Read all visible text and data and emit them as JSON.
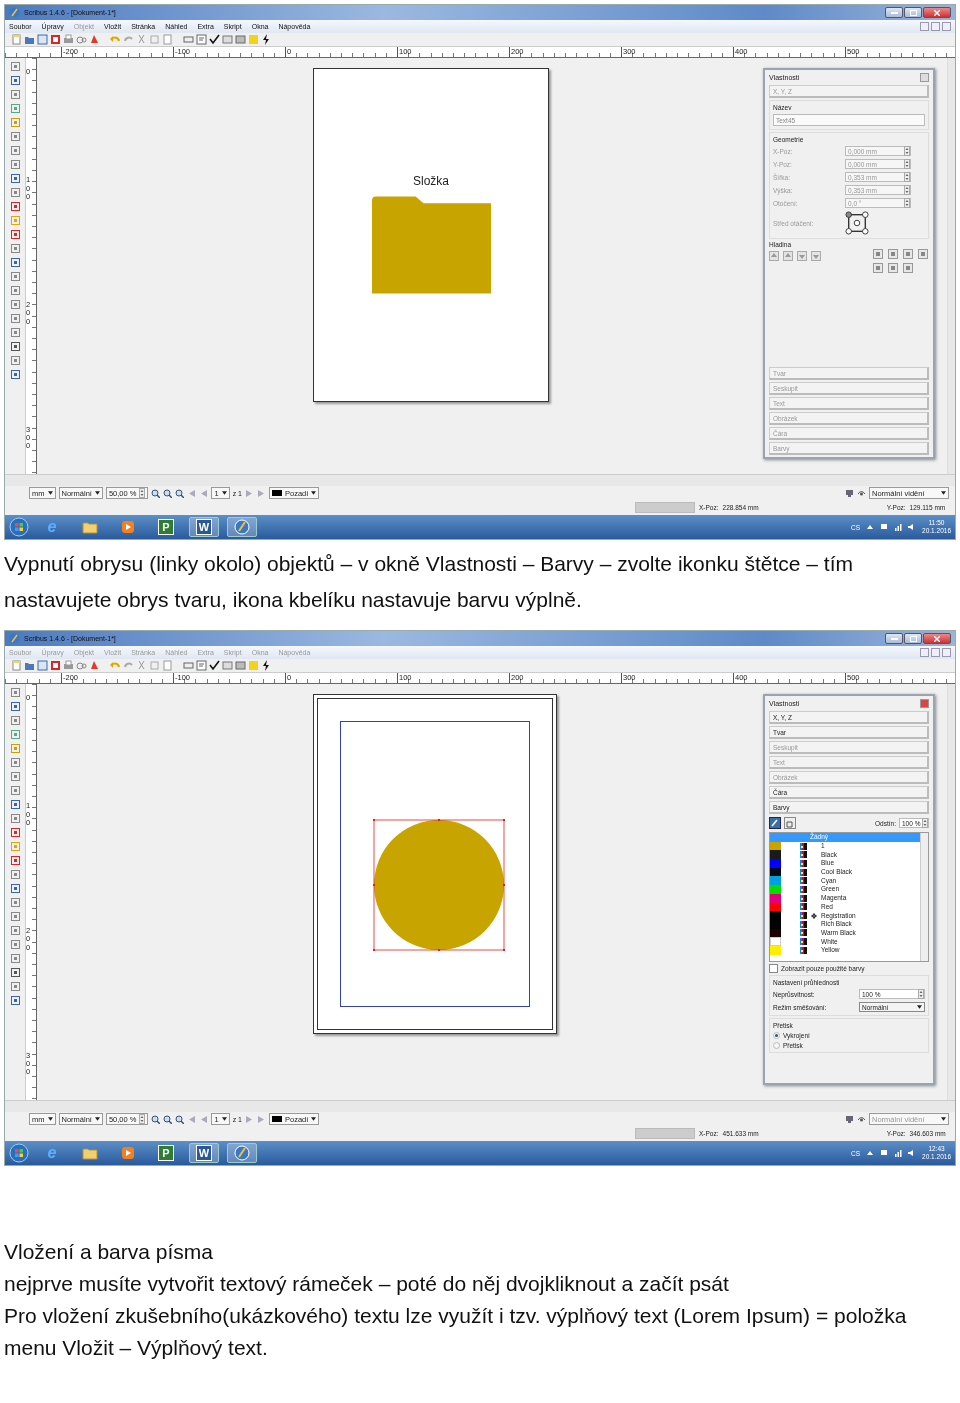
{
  "blocks": [
    {
      "kind": "screenshot",
      "title": "Scribus 1.4.6 - [Dokument-1*]",
      "menu": [
        {
          "label": "Soubor",
          "disabled": false
        },
        {
          "label": "Úpravy",
          "disabled": false
        },
        {
          "label": "Objekt",
          "disabled": true
        },
        {
          "label": "Vložit",
          "disabled": false
        },
        {
          "label": "Stránka",
          "disabled": false
        },
        {
          "label": "Náhled",
          "disabled": false
        },
        {
          "label": "Extra",
          "disabled": false
        },
        {
          "label": "Skript",
          "disabled": false
        },
        {
          "label": "Okna",
          "disabled": false
        },
        {
          "label": "Nápověda",
          "disabled": false
        }
      ],
      "ruler": [
        "-200",
        "-100",
        "0",
        "100",
        "200",
        "300",
        "400",
        "500"
      ],
      "vruler": [
        "0",
        "100",
        "200",
        "300"
      ],
      "canvas": {
        "kind": "folder",
        "label": "Složka"
      },
      "panel": {
        "kind": "geometry",
        "title": "Vlastnosti",
        "top_sections": [
          {
            "label": "X, Y, Z",
            "disabled": true
          }
        ],
        "name_label": "Název",
        "name_value": "Text45",
        "geometry_label": "Geometrie",
        "fields": [
          {
            "label": "X-Poz:",
            "value": "0,000 mm",
            "disabled": true
          },
          {
            "label": "Y-Poz:",
            "value": "0,000 mm",
            "disabled": true
          },
          {
            "label": "Šířka:",
            "value": "0,353 mm",
            "disabled": true
          },
          {
            "label": "Výška:",
            "value": "0,353 mm",
            "disabled": true
          },
          {
            "label": "Otočení:",
            "value": "0,0 °",
            "disabled": true
          }
        ],
        "pivot_label": "Střed otáčení:",
        "layer_label": "Hladina",
        "bottom_sections": [
          {
            "label": "Tvar",
            "disabled": true
          },
          {
            "label": "Seskupit",
            "disabled": true
          },
          {
            "label": "Text",
            "disabled": true
          },
          {
            "label": "Obrázek",
            "disabled": true
          },
          {
            "label": "Čára",
            "disabled": true
          },
          {
            "label": "Barvy",
            "disabled": true
          }
        ]
      },
      "bottombar": {
        "unit": "mm",
        "mode": "Normální",
        "zoom": "50,00 %",
        "page": "1",
        "page_of": "z 1",
        "layer": "Pozadí",
        "view": "Normální vidění",
        "view_disabled": false
      },
      "status": {
        "x_label": "X-Poz:",
        "x_value": "228.854 mm",
        "y_label": "Y-Poz:",
        "y_value": "129.115 mm"
      },
      "taskbar": {
        "apps": [
          {
            "kind": "browser",
            "glyph": "e",
            "active": false
          },
          {
            "kind": "folder",
            "active": false
          },
          {
            "kind": "media",
            "active": false
          },
          {
            "kind": "project",
            "glyph": "P",
            "active": false
          },
          {
            "kind": "word",
            "glyph": "W",
            "active": true
          },
          {
            "kind": "scribus",
            "active": true
          }
        ],
        "lang": "CS",
        "time": "11:50",
        "date": "20.1.2016"
      }
    },
    {
      "kind": "paragraph",
      "text": "Vypnutí obrysu (linky okolo) objektů – v okně Vlastnosti – Barvy – zvolte ikonku štětce – tím nastavujete obrys tvaru, ikona kbelíku nastavuje barvu výplně."
    },
    {
      "kind": "screenshot",
      "title": "Scribus 1.4.6 - [Dokument-1*]",
      "menu": [
        {
          "label": "Soubor",
          "disabled": true
        },
        {
          "label": "Úpravy",
          "disabled": true
        },
        {
          "label": "Objekt",
          "disabled": true
        },
        {
          "label": "Vložit",
          "disabled": true
        },
        {
          "label": "Stránka",
          "disabled": true
        },
        {
          "label": "Náhled",
          "disabled": true
        },
        {
          "label": "Extra",
          "disabled": true
        },
        {
          "label": "Skript",
          "disabled": true
        },
        {
          "label": "Okna",
          "disabled": true
        },
        {
          "label": "Nápověda",
          "disabled": true
        }
      ],
      "ruler": [
        "-200",
        "-100",
        "0",
        "100",
        "200",
        "300",
        "400",
        "500"
      ],
      "vruler": [
        "0",
        "100",
        "200",
        "300"
      ],
      "canvas": {
        "kind": "circle"
      },
      "panel": {
        "kind": "colors",
        "title": "Vlastnosti",
        "sections": [
          {
            "label": "X, Y, Z",
            "disabled": false
          },
          {
            "label": "Tvar",
            "disabled": false
          },
          {
            "label": "Seskupit",
            "disabled": true
          },
          {
            "label": "Text",
            "disabled": true
          },
          {
            "label": "Obrázek",
            "disabled": true
          },
          {
            "label": "Čára",
            "disabled": false
          },
          {
            "label": "Barvy",
            "disabled": false
          }
        ],
        "shade_label": "Odstín:",
        "shade_value": "100 %",
        "colors": [
          {
            "name": "Žádný",
            "selected": true
          },
          {
            "name": "1",
            "color": "#c8a400",
            "selected": false
          },
          {
            "name": "Black",
            "color": "#1a1a1a",
            "selected": false
          },
          {
            "name": "Blue",
            "color": "#0000ff",
            "selected": false
          },
          {
            "name": "Cool Black",
            "color": "#050a14",
            "selected": false
          },
          {
            "name": "Cyan",
            "color": "#00a0e0",
            "selected": false
          },
          {
            "name": "Green",
            "color": "#00e000",
            "selected": false
          },
          {
            "name": "Magenta",
            "color": "#e0007a",
            "selected": false
          },
          {
            "name": "Red",
            "color": "#ff0000",
            "selected": false
          },
          {
            "name": "Registration",
            "color": "#000000",
            "selected": false,
            "registration": true
          },
          {
            "name": "Rich Black",
            "color": "#020202",
            "selected": false
          },
          {
            "name": "Warm Black",
            "color": "#1a0000",
            "selected": false
          },
          {
            "name": "White",
            "color": "#ffffff",
            "selected": false
          },
          {
            "name": "Yellow",
            "color": "#ffee00",
            "selected": false
          }
        ],
        "only_used": {
          "label": "Zobrazit pouze použité barvy",
          "checked": false
        },
        "transparency_label": "Nastavení průhlednosti",
        "opacity_label": "Neprůsvitnost:",
        "opacity_value": "100 %",
        "blend_label": "Režim směšování:",
        "blend_value": "Normální",
        "overprint_label": "Přetisk",
        "overprint": [
          {
            "label": "Vykrojení",
            "selected": true
          },
          {
            "label": "Přetisk",
            "selected": false
          }
        ]
      },
      "bottombar": {
        "unit": "mm",
        "mode": "Normální",
        "zoom": "50,00 %",
        "page": "1",
        "page_of": "z 1",
        "layer": "Pozadí",
        "view": "Normální vidění",
        "view_disabled": true
      },
      "status": {
        "x_label": "X-Poz:",
        "x_value": "451.633 mm",
        "y_label": "Y-Poz:",
        "y_value": "346.603 mm"
      },
      "taskbar": {
        "apps": [
          {
            "kind": "browser",
            "glyph": "e",
            "active": false
          },
          {
            "kind": "folder",
            "active": false
          },
          {
            "kind": "media",
            "active": false
          },
          {
            "kind": "project",
            "glyph": "P",
            "active": false
          },
          {
            "kind": "word",
            "glyph": "W",
            "active": true
          },
          {
            "kind": "scribus",
            "active": true
          }
        ],
        "lang": "CS",
        "time": "12:43",
        "date": "20.1.2016"
      }
    },
    {
      "kind": "heading",
      "text": "Vložení a barva písma"
    },
    {
      "kind": "paragraph",
      "text": "nejprve musíte vytvořit textový rámeček – poté do něj  dvojkliknout a začít psát"
    },
    {
      "kind": "paragraph",
      "text": "Pro vložení zkušebního(ukázkového) textu lze využít i tzv. výplňový text (Lorem Ipsum) = položka menu Vložit – Výplňový text."
    }
  ]
}
